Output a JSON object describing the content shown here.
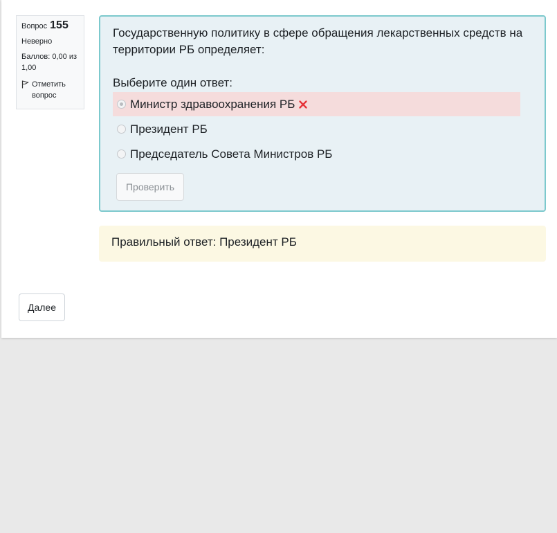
{
  "question_info": {
    "number_label": "Вопрос",
    "number": "155",
    "state": "Неверно",
    "grade": "Баллов: 0,00 из 1,00",
    "flag_label": "Отметить вопрос"
  },
  "question": {
    "text": "Государственную политику в сфере обращения лекарственных средств на территории РБ определяет:",
    "prompt": "Выберите один ответ:",
    "answers": [
      {
        "label": "Министр здравоохранения РБ",
        "selected": true,
        "status": "incorrect"
      },
      {
        "label": "Президент РБ",
        "selected": false,
        "status": "none"
      },
      {
        "label": "Председатель Совета Министров РБ",
        "selected": false,
        "status": "none"
      }
    ],
    "check_button": "Проверить"
  },
  "feedback": {
    "right_answer": "Правильный ответ: Президент РБ"
  },
  "navigation": {
    "next_button": "Далее"
  },
  "colors": {
    "formulation_bg": "#e8f1f5",
    "formulation_border": "#7cc9cd",
    "incorrect_bg": "#f5dcdc",
    "incorrect_icon": "#e5343a",
    "outcome_bg": "#fcf8e3"
  }
}
